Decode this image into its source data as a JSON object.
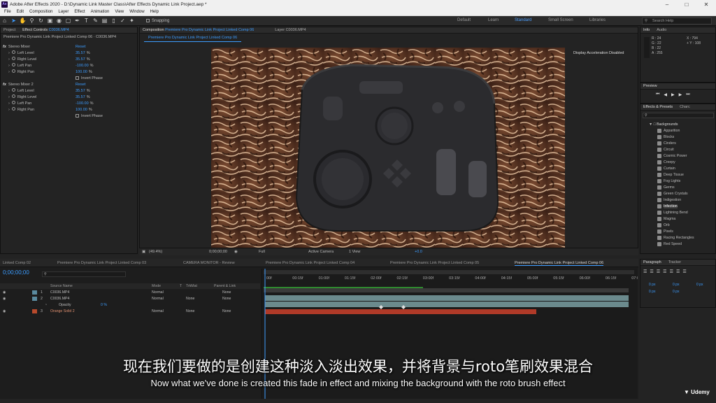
{
  "titlebar": {
    "title": "Adobe After Effects 2020 - D:\\Dynamic Link Master Class\\After Effects Dynamic Link Project.aep *",
    "logo": "Ae"
  },
  "menu": [
    "File",
    "Edit",
    "Composition",
    "Layer",
    "Effect",
    "Animation",
    "View",
    "Window",
    "Help"
  ],
  "toolbar": {
    "snapping_label": "Snapping"
  },
  "workspaces": [
    "Default",
    "Learn",
    "Standard",
    "Small Screen",
    "Libraries"
  ],
  "workspace_active": "Standard",
  "search_help": {
    "placeholder": "Search Help"
  },
  "project_panel": {
    "project_tab": "Project",
    "effect_controls_tab": "Effect Controls",
    "effect_controls_layer": "C0036.MP4",
    "breadcrumb": "Premiere Pro Dynamic Link Project Linked Comp 06 · C0036.MP4"
  },
  "effects": [
    {
      "name": "Stereo Mixer",
      "reset": "Reset",
      "params": [
        {
          "label": "Left Level",
          "value": "35.57",
          "unit": "%"
        },
        {
          "label": "Right Level",
          "value": "35.57",
          "unit": "%"
        },
        {
          "label": "Left Pan",
          "value": "-100.00",
          "unit": "%"
        },
        {
          "label": "Right Pan",
          "value": "100.00",
          "unit": "%"
        }
      ],
      "invert": "Invert Phase"
    },
    {
      "name": "Stereo Mixer 2",
      "reset": "Reset",
      "params": [
        {
          "label": "Left Level",
          "value": "35.57",
          "unit": "%"
        },
        {
          "label": "Right Level",
          "value": "35.57",
          "unit": "%"
        },
        {
          "label": "Left Pan",
          "value": "-100.00",
          "unit": "%"
        },
        {
          "label": "Right Pan",
          "value": "100.00",
          "unit": "%"
        }
      ],
      "invert": "Invert Phase"
    }
  ],
  "comp_panel": {
    "tab_label": "Composition",
    "comp_name": "Premiere Pro Dynamic Link Project Linked Comp 06",
    "layer_tab": "Layer C0036.MP4",
    "flow_tab": "Premiere Pro Dynamic Link Project Linked Comp 06",
    "display_accel": "Display Acceleration Disabled"
  },
  "viewer_bar": {
    "zoom": "(49.4%)",
    "timecode": "0;00;00;00",
    "resolution": "Full",
    "camera": "Active Camera",
    "views": "1 View",
    "exposure": "+0.0"
  },
  "info_panel": {
    "tab": "Info",
    "audio_tab": "Audio",
    "R": "R : 24",
    "G": "G : 22",
    "B": "B : 22",
    "A": "A : 255",
    "X": "X : 794",
    "Y": "+ Y : 108"
  },
  "preview_panel": {
    "tab": "Preview"
  },
  "effects_presets": {
    "tab": "Effects & Presets",
    "char_tab": "Charc",
    "folder": "Backgrounds",
    "items": [
      "Apparition",
      "Blocks",
      "Cinders",
      "Circuit",
      "Cosmic Power",
      "Creepy",
      "Curtain",
      "Deep Tissue",
      "Fog Lights",
      "Germs",
      "Green Crystals",
      "Indigestion",
      "Infection",
      "Lightning Bend",
      "Magma",
      "Orb",
      "Pixels",
      "Racing Rectangles",
      "Red Speed"
    ],
    "selected": "Infection"
  },
  "timeline": {
    "tabs": [
      "Linked Comp 02",
      "Premiere Pro Dynamic Link Project Linked Comp 03",
      "CAMERA MONITOR - Review",
      "Premiere Pro Dynamic Link Project Linked Comp 04",
      "Premiere Pro Dynamic Link Project Linked Comp 05",
      "Premiere Pro Dynamic Link Project Linked Comp 06"
    ],
    "timecode": "0;00;00;00",
    "columns": {
      "source_name": "Source Name",
      "mode": "Mode",
      "t": "T",
      "trkmat": "TrkMat",
      "parent": "Parent & Link"
    },
    "ruler": [
      "00f",
      "00:15f",
      "01:00f",
      "01:15f",
      "02:00f",
      "02:15f",
      "03:00f",
      "03:15f",
      "04:00f",
      "04:15f",
      "05:00f",
      "05:15f",
      "06:00f",
      "06:15f",
      "07:0"
    ],
    "layers": [
      {
        "num": "1",
        "name": "C0036.MP4",
        "mode": "Normal",
        "trkmat": "",
        "parent": "None",
        "color": "#5a8a9e"
      },
      {
        "num": "2",
        "name": "C0036.MP4",
        "mode": "Normal",
        "trkmat": "None",
        "parent": "None",
        "color": "#5a8a9e"
      },
      {
        "num": "",
        "name": "Opacity",
        "mode": "",
        "trkmat": "",
        "parent": "",
        "value": "0 %",
        "color": ""
      },
      {
        "num": "3",
        "name": "Orange Solid 2",
        "mode": "Normal",
        "trkmat": "None",
        "parent": "None",
        "color": "#b84a2c"
      }
    ]
  },
  "paragraph_panel": {
    "tab": "Paragraph",
    "tracker_tab": "Tracker",
    "values": [
      "0 px",
      "0 px",
      "0 px",
      "0 px",
      "0 px"
    ]
  },
  "subtitles": {
    "cn": "现在我们要做的是创建这种淡入淡出效果，并将背景与roto笔刷效果混合",
    "en": "Now what we've done is created this fade in effect and mixing the background with the roto brush effect"
  },
  "watermark": "Udemy",
  "colors": {
    "accent": "#3c9cff",
    "layer_bar": "#6b8a8d",
    "solid_bar": "#b03a28",
    "playhead": "#3c9cff"
  }
}
